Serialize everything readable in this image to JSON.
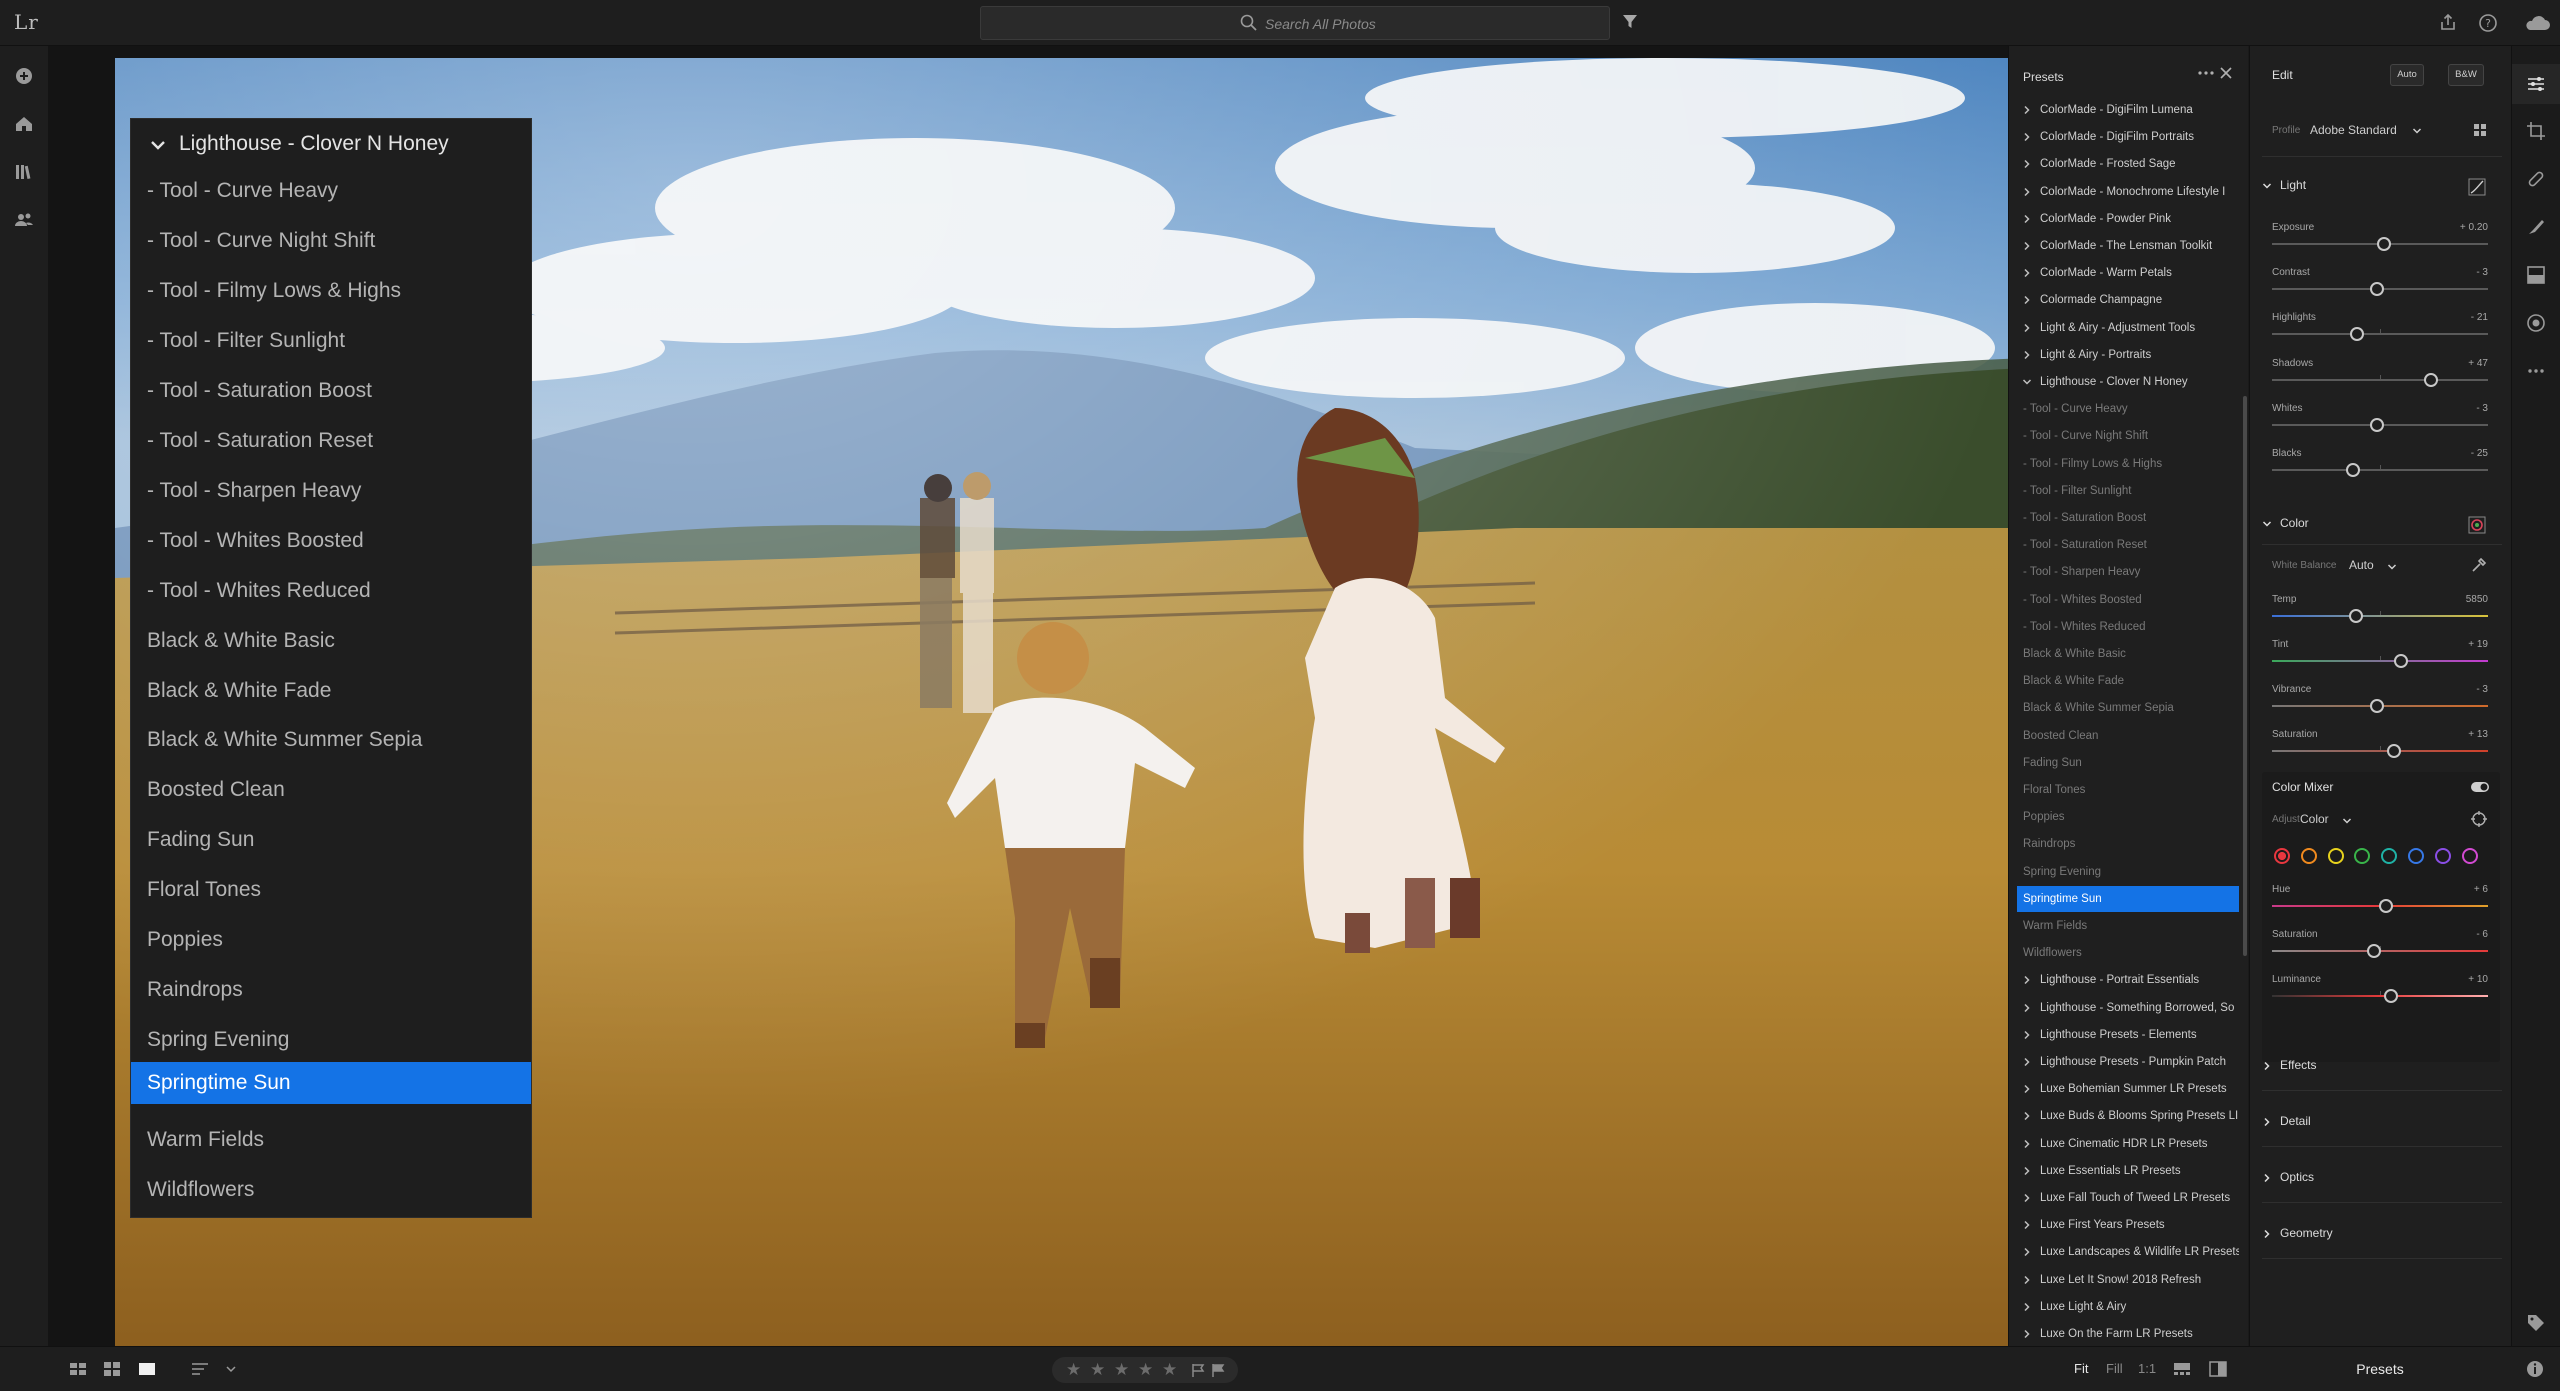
{
  "app": {
    "logo": "Lr"
  },
  "search": {
    "placeholder": "Search All Photos"
  },
  "popup": {
    "title": "Lighthouse - Clover N Honey",
    "items": [
      "- Tool - Curve Heavy",
      "- Tool - Curve Night Shift",
      "- Tool - Filmy Lows & Highs",
      "- Tool - Filter Sunlight",
      "- Tool - Saturation Boost",
      "- Tool - Saturation Reset",
      "- Tool - Sharpen Heavy",
      "- Tool - Whites Boosted",
      "- Tool - Whites Reduced",
      "Black & White Basic",
      "Black & White Fade",
      "Black & White Summer Sepia",
      "Boosted Clean",
      "Fading Sun",
      "Floral Tones",
      "Poppies",
      "Raindrops",
      "Spring Evening",
      "Springtime Sun",
      "Warm Fields",
      "Wildflowers"
    ],
    "selected_index": 18
  },
  "presets": {
    "title": "Presets",
    "rows": [
      {
        "label": "ColorMade - DigiFilm Lumena",
        "type": "group"
      },
      {
        "label": "ColorMade - DigiFilm Portraits",
        "type": "group"
      },
      {
        "label": "ColorMade - Frosted Sage",
        "type": "group"
      },
      {
        "label": "ColorMade - Monochrome Lifestyle I",
        "type": "group"
      },
      {
        "label": "ColorMade - Powder Pink",
        "type": "group"
      },
      {
        "label": "ColorMade - The Lensman Toolkit",
        "type": "group"
      },
      {
        "label": "ColorMade - Warm Petals",
        "type": "group"
      },
      {
        "label": "Colormade Champagne",
        "type": "group"
      },
      {
        "label": "Light & Airy - Adjustment Tools",
        "type": "group"
      },
      {
        "label": "Light & Airy - Portraits",
        "type": "group"
      },
      {
        "label": "Lighthouse - Clover N Honey",
        "type": "group-open"
      },
      {
        "label": "- Tool - Curve Heavy",
        "type": "child"
      },
      {
        "label": "- Tool - Curve Night Shift",
        "type": "child"
      },
      {
        "label": "- Tool - Filmy Lows & Highs",
        "type": "child"
      },
      {
        "label": "- Tool - Filter Sunlight",
        "type": "child"
      },
      {
        "label": "- Tool - Saturation Boost",
        "type": "child"
      },
      {
        "label": "- Tool - Saturation Reset",
        "type": "child"
      },
      {
        "label": "- Tool - Sharpen Heavy",
        "type": "child"
      },
      {
        "label": "- Tool - Whites Boosted",
        "type": "child"
      },
      {
        "label": "- Tool - Whites Reduced",
        "type": "child"
      },
      {
        "label": "Black & White Basic",
        "type": "child"
      },
      {
        "label": "Black & White Fade",
        "type": "child"
      },
      {
        "label": "Black & White Summer Sepia",
        "type": "child"
      },
      {
        "label": "Boosted Clean",
        "type": "child"
      },
      {
        "label": "Fading Sun",
        "type": "child"
      },
      {
        "label": "Floral Tones",
        "type": "child"
      },
      {
        "label": "Poppies",
        "type": "child"
      },
      {
        "label": "Raindrops",
        "type": "child"
      },
      {
        "label": "Spring Evening",
        "type": "child"
      },
      {
        "label": "Springtime Sun",
        "type": "selected"
      },
      {
        "label": "Warm Fields",
        "type": "child"
      },
      {
        "label": "Wildflowers",
        "type": "child"
      },
      {
        "label": "Lighthouse - Portrait Essentials",
        "type": "group"
      },
      {
        "label": "Lighthouse - Something Borrowed, So",
        "type": "group"
      },
      {
        "label": "Lighthouse Presets - Elements",
        "type": "group"
      },
      {
        "label": "Lighthouse Presets - Pumpkin Patch",
        "type": "group"
      },
      {
        "label": "Luxe Bohemian Summer LR Presets",
        "type": "group"
      },
      {
        "label": "Luxe Buds & Blooms Spring Presets LI",
        "type": "group"
      },
      {
        "label": "Luxe Cinematic HDR LR Presets",
        "type": "group"
      },
      {
        "label": "Luxe Essentials LR Presets",
        "type": "group"
      },
      {
        "label": "Luxe Fall Touch of Tweed LR Presets",
        "type": "group"
      },
      {
        "label": "Luxe First Years Presets",
        "type": "group"
      },
      {
        "label": "Luxe Landscapes & Wildlife LR Presets",
        "type": "group"
      },
      {
        "label": "Luxe Let It Snow! 2018 Refresh",
        "type": "group"
      },
      {
        "label": "Luxe Light & Airy",
        "type": "group"
      },
      {
        "label": "Luxe On the Farm LR Presets",
        "type": "group"
      }
    ]
  },
  "edit": {
    "title": "Edit",
    "auto_label": "Auto",
    "bw_label": "B&W",
    "profile_label": "Profile",
    "profile_value": "Adobe Standard",
    "light": {
      "title": "Light",
      "sliders": [
        {
          "label": "Exposure",
          "value_text": "+ 0.20",
          "level": 0.52
        },
        {
          "label": "Contrast",
          "value_text": "- 3",
          "level": 0.485
        },
        {
          "label": "Highlights",
          "value_text": "- 21",
          "level": 0.395
        },
        {
          "label": "Shadows",
          "value_text": "+ 47",
          "level": 0.735
        },
        {
          "label": "Whites",
          "value_text": "- 3",
          "level": 0.485
        },
        {
          "label": "Blacks",
          "value_text": "- 25",
          "level": 0.375
        }
      ]
    },
    "color": {
      "title": "Color",
      "wb_label": "White Balance",
      "wb_value": "Auto",
      "sliders": [
        {
          "label": "Temp",
          "value_text": "5850",
          "level": 0.39
        },
        {
          "label": "Tint",
          "value_text": "+ 19",
          "level": 0.595
        },
        {
          "label": "Vibrance",
          "value_text": "- 3",
          "level": 0.485
        },
        {
          "label": "Saturation",
          "value_text": "+ 13",
          "level": 0.565
        }
      ]
    },
    "mixer": {
      "title": "Color Mixer",
      "adjust_label": "Adjust",
      "adjust_value": "Color",
      "swatches": [
        "#e8373f",
        "#f08a1e",
        "#e7d21d",
        "#39b54a",
        "#1fb2a6",
        "#3678e6",
        "#8a4ee6",
        "#d24ad2"
      ],
      "sliders": [
        {
          "label": "Hue",
          "value_text": "+ 6",
          "level": 0.53
        },
        {
          "label": "Saturation",
          "value_text": "- 6",
          "level": 0.47
        },
        {
          "label": "Luminance",
          "value_text": "+ 10",
          "level": 0.55
        }
      ]
    },
    "sections": [
      "Effects",
      "Detail",
      "Optics",
      "Geometry"
    ]
  },
  "bottom": {
    "zoom_options": [
      "Fit",
      "Fill",
      "1:1"
    ],
    "zoom_active": "Fit",
    "presets_tab": "Presets",
    "stars": "★★★★★"
  },
  "colors": {
    "accent": "#1473e6",
    "panel": "#1f1f1f",
    "background": "#1a1a1a"
  }
}
